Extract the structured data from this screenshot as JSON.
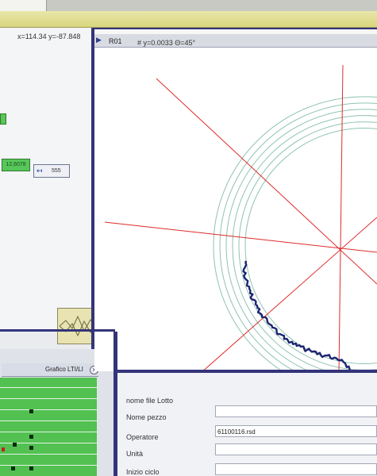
{
  "toolbar": {},
  "left_panel": {
    "coordinates": "x=114.34 y=-87.848",
    "green_value": "12,6078",
    "count_value": "555"
  },
  "plot": {
    "tab_label": "R01",
    "readout": "# y=0.0033 Θ=45°",
    "colors": {
      "profile": "#1d2472",
      "axes": "#dd2b2b",
      "rings": "#8fc3b1"
    }
  },
  "grafico": {
    "title": "Grafico LTI/LI",
    "close_symbol": "x"
  },
  "form": {
    "nome_file_label": "nome file Lotto",
    "nome_pezzo_label": "Nome pezzo",
    "operatore_label": "Operatore",
    "operatore_value": "61100116.rsd",
    "unita_label": "Unità",
    "inizio_label": "Inizio ciclo"
  }
}
